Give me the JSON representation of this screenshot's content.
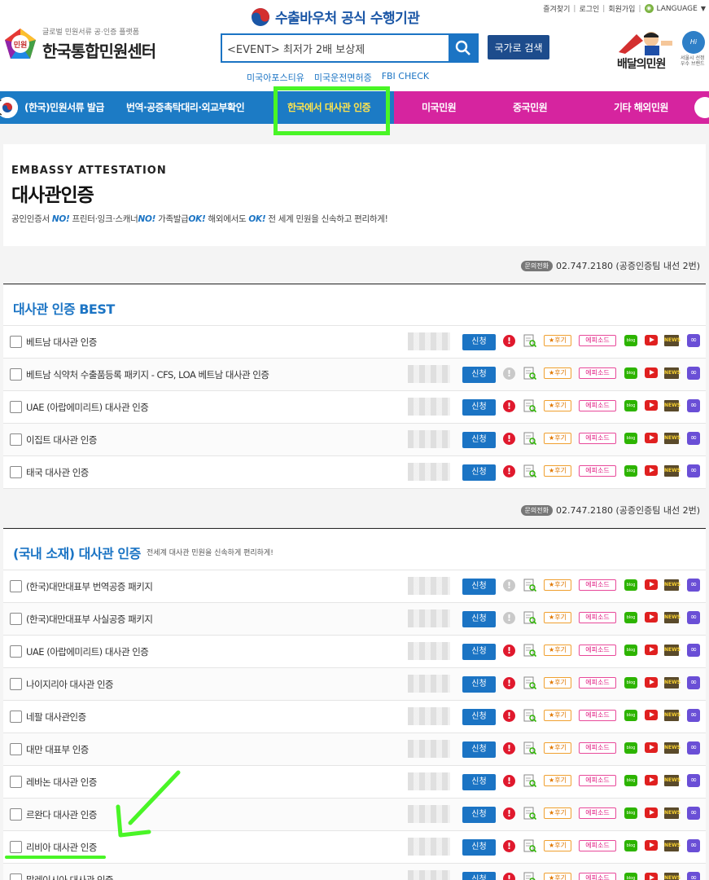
{
  "header": {
    "top_links": [
      "즐겨찾기",
      "로그인",
      "회원가입"
    ],
    "language_label": "LANGUAGE",
    "logo_tagline": "글로벌 민원서류 공·인증 플랫폼",
    "logo_name": "한국통합민원센터",
    "logo_badge": "민원",
    "gov_title": "수출바우처 공식 수행기관",
    "search_value": "<EVENT> 최저가 2배 보상제",
    "country_search_label": "국가로 검색",
    "quick_links": [
      "미국아포스티유",
      "미국운전면허증",
      "FBI CHECK"
    ],
    "baedal_name": "배달의민원",
    "hiseoul_label": "Hi Seoul",
    "hiseoul_sub": "서울시 선정 우수 브랜드"
  },
  "nav": {
    "items": [
      {
        "label": "(한국)민원서류 발급"
      },
      {
        "label": "번역·공증촉탁대리·외교부확인"
      },
      {
        "label": "한국에서 대사관 인증",
        "active": true
      },
      {
        "label": "미국민원"
      },
      {
        "label": "중국민원"
      },
      {
        "label": "기타 해외민원"
      }
    ]
  },
  "hero": {
    "eng": "EMBASSY ATTESTATION",
    "title": "대사관인증",
    "desc_parts": [
      {
        "t": "공인인증서 "
      },
      {
        "t": "NO!",
        "b": true
      },
      {
        "t": " 프린터·잉크·스캐너"
      },
      {
        "t": "NO!",
        "b": true
      },
      {
        "t": " 가족발급"
      },
      {
        "t": "OK!",
        "b": true
      },
      {
        "t": " 해외에서도 "
      },
      {
        "t": "OK!",
        "b": true
      },
      {
        "t": " 전 세계 민원을 신속하고 편리하게!"
      }
    ]
  },
  "contact": {
    "badge": "문의전화",
    "text": "02.747.2180 (공증인증팀 내선 2번)"
  },
  "row_labels": {
    "apply": "신청",
    "review": "★후기",
    "episode": "에피소드",
    "blog": "blog",
    "news": "NEWS"
  },
  "section_best": {
    "title": "대사관 인증 BEST",
    "rows": [
      {
        "label": "베트남 대사관 인증",
        "alert_active": true
      },
      {
        "label": "베트남 식약처 수출품등록 패키지 - CFS, LOA 베트남 대사관 인증",
        "alert_active": false
      },
      {
        "label": "UAE (아랍에미리트) 대사관 인증",
        "alert_active": true
      },
      {
        "label": "이집트 대사관 인증",
        "alert_active": true
      },
      {
        "label": "태국 대사관 인증",
        "alert_active": true
      }
    ]
  },
  "section_domestic": {
    "title": "(국내 소재) 대사관 인증",
    "subtitle": "전세계 대사관 민원을 신속하게 편리하게!",
    "rows": [
      {
        "label": "(한국)대만대표부 번역공증 패키지",
        "alert_active": false
      },
      {
        "label": "(한국)대만대표부 사실공증 패키지",
        "alert_active": false
      },
      {
        "label": "UAE (아랍에미리트) 대사관 인증",
        "alert_active": true
      },
      {
        "label": "나이지리아 대사관 인증",
        "alert_active": true
      },
      {
        "label": "네팔 대사관인증",
        "alert_active": true
      },
      {
        "label": "대만 대표부 인증",
        "alert_active": true
      },
      {
        "label": "레바논 대사관 인증",
        "alert_active": true
      },
      {
        "label": "르완다 대사관 인증",
        "alert_active": true
      },
      {
        "label": "리비아 대사관 인증",
        "alert_active": true
      },
      {
        "label": "말레이시아 대사관 인증",
        "alert_active": true
      }
    ]
  },
  "colors": {
    "nav_blue": "#1c7bc5",
    "nav_pink": "#d6249f",
    "active_nav_text": "#ffe44d",
    "highlight": "#49f526",
    "accent": "#1b74c4"
  }
}
